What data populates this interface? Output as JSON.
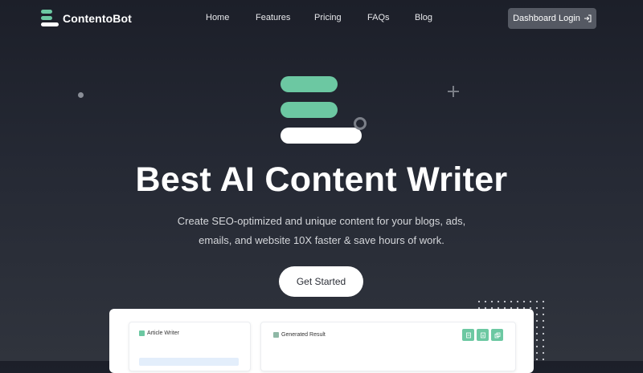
{
  "brand": {
    "name": "ContentoBot"
  },
  "nav": {
    "items": [
      "Home",
      "Features",
      "Pricing",
      "FAQs",
      "Blog"
    ]
  },
  "header": {
    "login_label": "Dashboard Login",
    "login_icon": "login-arrow-icon"
  },
  "hero": {
    "title": "Best AI Content Writer",
    "subtitle": "Create SEO-optimized and unique content for your blogs, ads, emails, and website 10X faster & save hours of work.",
    "cta_label": "Get Started"
  },
  "preview": {
    "left_panel_title": "Article Writer",
    "right_panel_title": "Generated Result",
    "tool_icons": [
      "copy-document-icon",
      "download-document-icon",
      "duplicate-icon"
    ]
  },
  "colors": {
    "accent": "#6cc8a2",
    "background": "#22252f",
    "button": "#555963"
  }
}
